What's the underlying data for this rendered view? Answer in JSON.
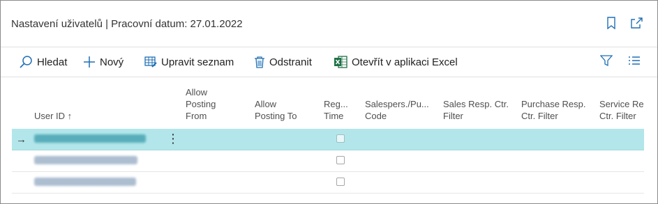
{
  "header": {
    "title": "Nastavení uživatelů | Pracovní datum: 27.01.2022",
    "icons": [
      "bookmark-icon",
      "open-new-window-icon"
    ]
  },
  "toolbar": {
    "search_label": "Hledat",
    "new_label": "Nový",
    "edit_list_label": "Upravit seznam",
    "delete_label": "Odstranit",
    "excel_label": "Otevřít v aplikaci Excel",
    "right_icons": [
      "filter-icon",
      "list-view-icon"
    ]
  },
  "columns": {
    "user_id": "User ID ↑",
    "allow_from": "Allow\nPosting\nFrom",
    "allow_to": "Allow\nPosting To",
    "reg_time": "Reg...\nTime",
    "salespers": "Salespers./Pu...\nCode",
    "sales_resp": "Sales Resp. Ctr.\nFilter",
    "purchase_resp": "Purchase Resp.\nCtr. Filter",
    "service_resp": "Service Res\nCtr. Filter"
  },
  "rows": [
    {
      "selected": true
    },
    {
      "selected": false
    },
    {
      "selected": false
    }
  ],
  "colors": {
    "selected_row": "#b2e6ea",
    "excel_green": "#1e7145",
    "accent_blue": "#0f6fc6"
  }
}
